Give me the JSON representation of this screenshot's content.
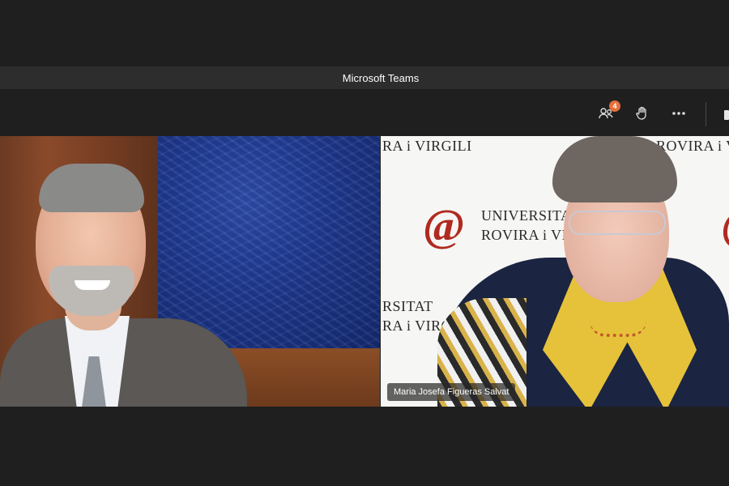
{
  "window": {
    "title": "Microsoft Teams"
  },
  "controls": {
    "participants": {
      "icon": "participants-icon",
      "badge_count": "4"
    },
    "raise_hand": {
      "icon": "raise-hand-icon"
    },
    "more": {
      "icon": "more-options-icon"
    }
  },
  "participants": [
    {
      "name": ""
    },
    {
      "name": "Maria Josefa Figueras Salvat"
    }
  ],
  "backdrop": {
    "lines": [
      "RA i VIRGILI",
      "ROVIRA i VIRGILI",
      "UNIVERSITAT",
      "ROVIRA i VI",
      "RSITAT",
      "RA i VIRGILI"
    ],
    "brand_color": "#b02a20"
  },
  "colors": {
    "badge": "#e46f3b",
    "title_bar": "#2d2d2d",
    "background": "#1f1f1f"
  }
}
